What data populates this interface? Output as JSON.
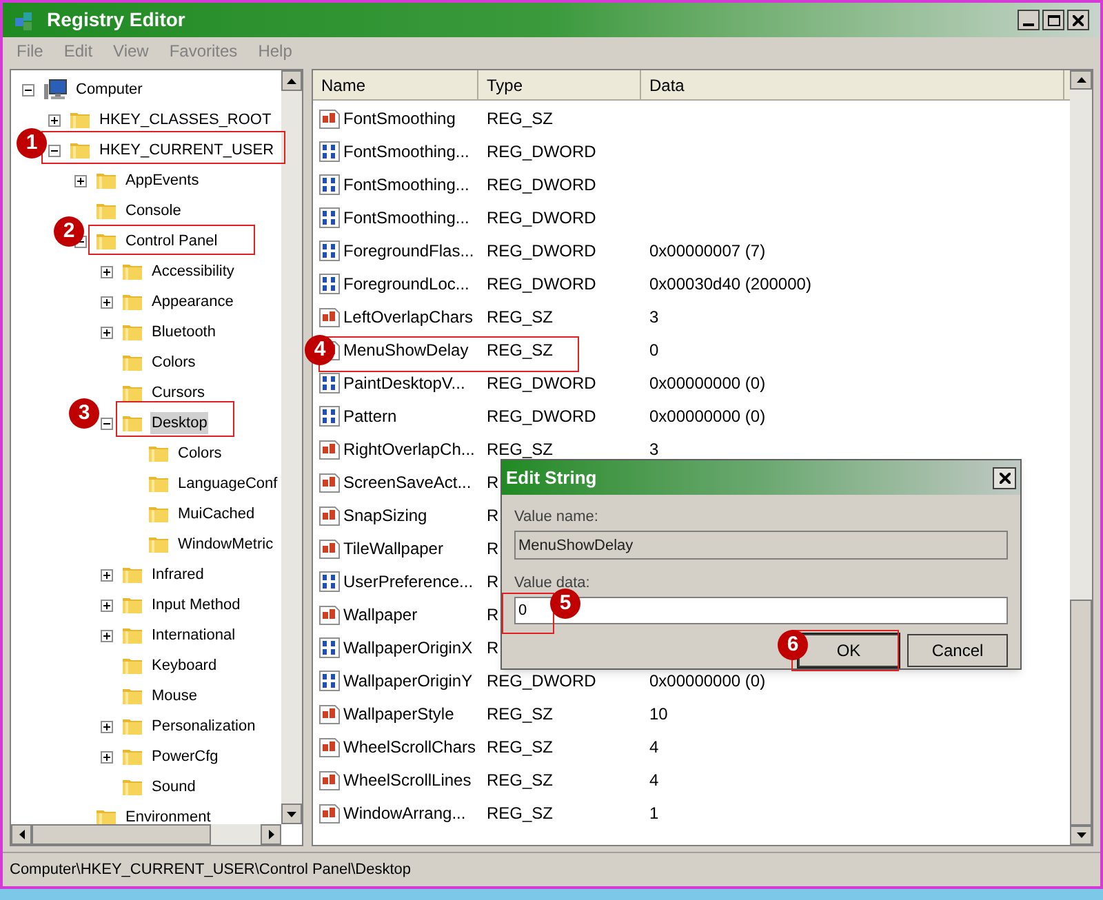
{
  "window": {
    "title": "Registry Editor"
  },
  "menu": [
    "File",
    "Edit",
    "View",
    "Favorites",
    "Help"
  ],
  "tree": {
    "label": "Computer",
    "kind": "branch",
    "expanded": true,
    "selected": false,
    "children": [
      {
        "label": "HKEY_CLASSES_ROOT",
        "kind": "branch",
        "expanded": false,
        "selected": false
      },
      {
        "label": "HKEY_CURRENT_USER",
        "kind": "branch",
        "expanded": true,
        "selected": false,
        "children": [
          {
            "label": "AppEvents",
            "kind": "branch",
            "expanded": false,
            "selected": false
          },
          {
            "label": "Console",
            "kind": "leaf",
            "selected": false
          },
          {
            "label": "Control Panel",
            "kind": "branch",
            "expanded": true,
            "selected": false,
            "children": [
              {
                "label": "Accessibility",
                "kind": "branch",
                "expanded": false,
                "selected": false
              },
              {
                "label": "Appearance",
                "kind": "branch",
                "expanded": false,
                "selected": false
              },
              {
                "label": "Bluetooth",
                "kind": "branch",
                "expanded": false,
                "selected": false
              },
              {
                "label": "Colors",
                "kind": "leaf",
                "selected": false
              },
              {
                "label": "Cursors",
                "kind": "leaf",
                "selected": false
              },
              {
                "label": "Desktop",
                "kind": "branch",
                "expanded": true,
                "selected": true,
                "children": [
                  {
                    "label": "Colors",
                    "kind": "leaf",
                    "selected": false
                  },
                  {
                    "label": "LanguageConf",
                    "kind": "leaf",
                    "selected": false
                  },
                  {
                    "label": "MuiCached",
                    "kind": "leaf",
                    "selected": false
                  },
                  {
                    "label": "WindowMetric",
                    "kind": "leaf",
                    "selected": false
                  }
                ]
              },
              {
                "label": "Infrared",
                "kind": "branch",
                "expanded": false,
                "selected": false
              },
              {
                "label": "Input Method",
                "kind": "branch",
                "expanded": false,
                "selected": false
              },
              {
                "label": "International",
                "kind": "branch",
                "expanded": false,
                "selected": false
              },
              {
                "label": "Keyboard",
                "kind": "leaf",
                "selected": false
              },
              {
                "label": "Mouse",
                "kind": "leaf",
                "selected": false
              },
              {
                "label": "Personalization",
                "kind": "branch",
                "expanded": false,
                "selected": false
              },
              {
                "label": "PowerCfg",
                "kind": "branch",
                "expanded": false,
                "selected": false
              },
              {
                "label": "Sound",
                "kind": "leaf",
                "selected": false
              }
            ]
          },
          {
            "label": "Environment",
            "kind": "leaf",
            "selected": false
          }
        ]
      }
    ]
  },
  "table": {
    "columns": [
      "Name",
      "Type",
      "Data"
    ],
    "rows": [
      {
        "kind": "string",
        "name": "FontSmoothing",
        "type": "REG_SZ"
      },
      {
        "kind": "dword",
        "name": "FontSmoothing...",
        "type": "REG_DWORD"
      },
      {
        "kind": "dword",
        "name": "FontSmoothing...",
        "type": "REG_DWORD"
      },
      {
        "kind": "dword",
        "name": "FontSmoothing...",
        "type": "REG_DWORD"
      },
      {
        "kind": "dword",
        "name": "ForegroundFlas...",
        "type": "REG_DWORD",
        "data": "0x00000007 (7)"
      },
      {
        "kind": "dword",
        "name": "ForegroundLoc...",
        "type": "REG_DWORD",
        "data": "0x00030d40 (200000)"
      },
      {
        "kind": "string",
        "name": "LeftOverlapChars",
        "type": "REG_SZ",
        "data": "3"
      },
      {
        "kind": "string",
        "name": "MenuShowDelay",
        "type": "REG_SZ",
        "data": "0"
      },
      {
        "kind": "dword",
        "name": "PaintDesktopV...",
        "type": "REG_DWORD",
        "data": "0x00000000 (0)"
      },
      {
        "kind": "dword",
        "name": "Pattern",
        "type": "REG_DWORD",
        "data": "0x00000000 (0)"
      },
      {
        "kind": "string",
        "name": "RightOverlapCh...",
        "type": "REG_SZ",
        "data": "3"
      },
      {
        "kind": "string",
        "name": "ScreenSaveAct...",
        "type": "R"
      },
      {
        "kind": "string",
        "name": "SnapSizing",
        "type": "R"
      },
      {
        "kind": "string",
        "name": "TileWallpaper",
        "type": "R"
      },
      {
        "kind": "dword",
        "name": "UserPreference...",
        "type": "R"
      },
      {
        "kind": "string",
        "name": "Wallpaper",
        "type": "R"
      },
      {
        "kind": "dword",
        "name": "WallpaperOriginX",
        "type": "R"
      },
      {
        "kind": "dword",
        "name": "WallpaperOriginY",
        "type": "REG_DWORD",
        "data": "0x00000000 (0)"
      },
      {
        "kind": "string",
        "name": "WallpaperStyle",
        "type": "REG_SZ",
        "data": "10"
      },
      {
        "kind": "string",
        "name": "WheelScrollChars",
        "type": "REG_SZ",
        "data": "4"
      },
      {
        "kind": "string",
        "name": "WheelScrollLines",
        "type": "REG_SZ",
        "data": "4"
      },
      {
        "kind": "string",
        "name": "WindowArrang...",
        "type": "REG_SZ",
        "data": "1"
      }
    ]
  },
  "dialog": {
    "title": "Edit String",
    "name_label": "Value name:",
    "name_value": "MenuShowDelay",
    "data_label": "Value data:",
    "data_value": "0",
    "buttons": [
      "OK",
      "Cancel"
    ]
  },
  "status_bar": "Computer\\HKEY_CURRENT_USER\\Control Panel\\Desktop",
  "annotations": [
    "1",
    "2",
    "3",
    "4",
    "5",
    "6"
  ]
}
